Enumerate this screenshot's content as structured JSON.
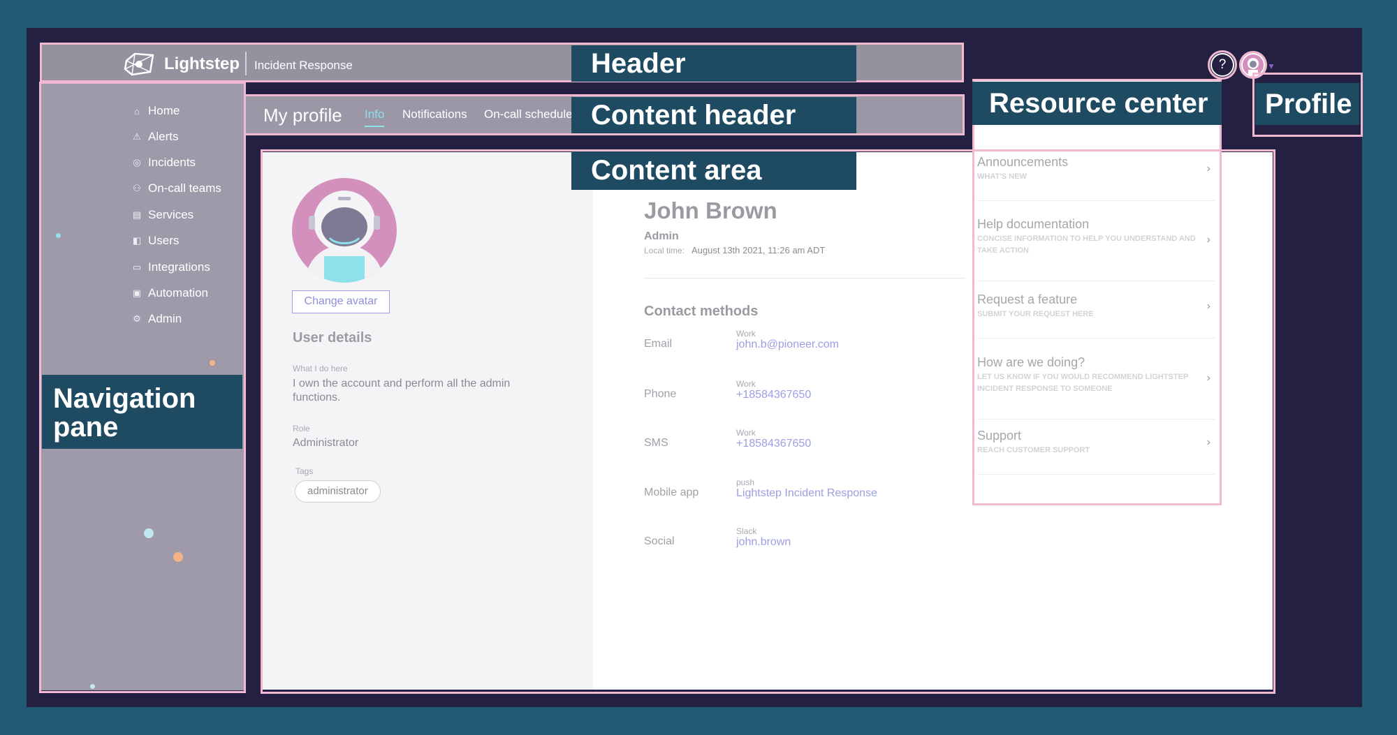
{
  "app": {
    "brand": "Lightstep",
    "product": "Incident Response"
  },
  "header_actions": {
    "help_glyph": "?"
  },
  "nav": {
    "items": [
      {
        "label": "Home",
        "icon": "home-icon",
        "glyph": "⌂"
      },
      {
        "label": "Alerts",
        "icon": "warning-icon",
        "glyph": "⚠"
      },
      {
        "label": "Incidents",
        "icon": "incident-icon",
        "glyph": "◎"
      },
      {
        "label": "On-call teams",
        "icon": "team-icon",
        "glyph": "⚇"
      },
      {
        "label": "Services",
        "icon": "services-icon",
        "glyph": "▤"
      },
      {
        "label": "Users",
        "icon": "users-icon",
        "glyph": "◧"
      },
      {
        "label": "Integrations",
        "icon": "integrations-icon",
        "glyph": "▭"
      },
      {
        "label": "Automation",
        "icon": "automation-icon",
        "glyph": "▣"
      },
      {
        "label": "Admin",
        "icon": "admin-icon",
        "glyph": "⚙"
      }
    ]
  },
  "content_header": {
    "title": "My profile",
    "tabs": [
      "Info",
      "Notifications",
      "On-call schedule"
    ],
    "active_tab": "Info"
  },
  "profile": {
    "change_avatar": "Change avatar",
    "user_details_title": "User details",
    "what_i_do_label": "What I do here",
    "what_i_do_value": "I own the account and perform all the admin functions.",
    "role_label": "Role",
    "role_value": "Administrator",
    "tags_label": "Tags",
    "tags": [
      "administrator"
    ],
    "name": "John Brown",
    "role": "Admin",
    "local_time_label": "Local time:",
    "local_time_value": "August 13th 2021, 11:26 am ADT",
    "contact_methods_title": "Contact methods",
    "contacts": [
      {
        "type": "Email",
        "label": "Work",
        "value": "john.b@pioneer.com"
      },
      {
        "type": "Phone",
        "label": "Work",
        "value": "+18584367650"
      },
      {
        "type": "SMS",
        "label": "Work",
        "value": "+18584367650"
      },
      {
        "type": "Mobile app",
        "label": "push",
        "value": "Lightstep Incident Response"
      },
      {
        "type": "Social",
        "label": "Slack",
        "value": "john.brown"
      }
    ]
  },
  "resource_center": {
    "items": [
      {
        "title": "Announcements",
        "subtitle": "WHAT'S NEW"
      },
      {
        "title": "Help documentation",
        "subtitle": "CONCISE INFORMATION TO HELP YOU UNDERSTAND AND TAKE ACTION"
      },
      {
        "title": "Request a feature",
        "subtitle": "SUBMIT YOUR REQUEST HERE"
      },
      {
        "title": "How are we doing?",
        "subtitle": "LET US KNOW IF YOU WOULD RECOMMEND LIGHTSTEP INCIDENT RESPONSE TO SOMEONE"
      },
      {
        "title": "Support",
        "subtitle": "REACH CUSTOMER SUPPORT"
      }
    ]
  },
  "annotations": {
    "header": "Header",
    "content_header": "Content header",
    "content_area": "Content area",
    "resource_center": "Resource center",
    "profile": "Profile",
    "navigation_pane": "Navigation pane"
  },
  "colors": {
    "background": "#225a74",
    "frame": "#232041",
    "annotation_bg": "#1f4b62",
    "highlight_border": "#f2b8d2",
    "link": "#9c9ee4",
    "active_tab": "#8ee0e9",
    "avatar_pink": "#d490bd"
  }
}
